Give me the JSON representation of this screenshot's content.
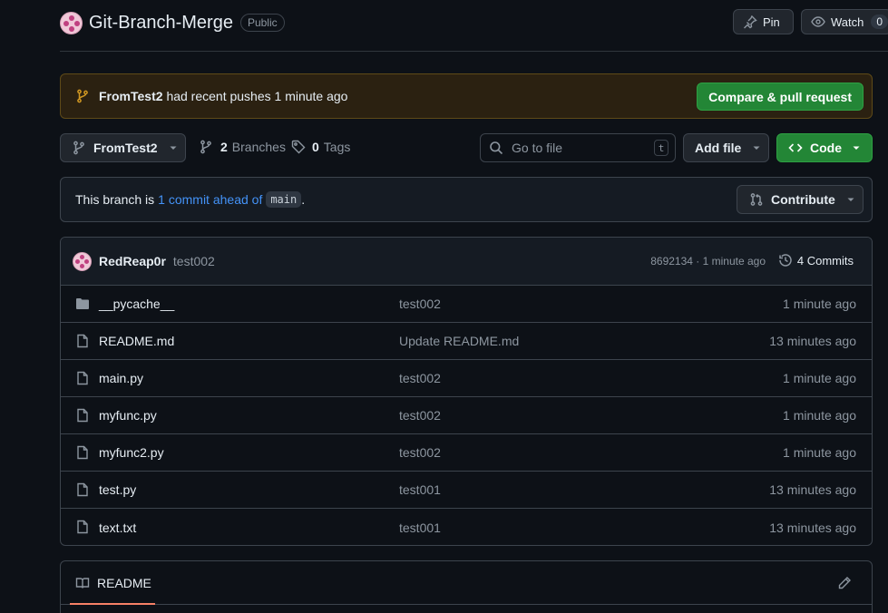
{
  "repo": {
    "name": "Git-Branch-Merge",
    "visibility": "Public",
    "pin_label": "Pin",
    "watch_label": "Watch",
    "watch_count": "0"
  },
  "banner": {
    "branch": "FromTest2",
    "text": "had recent pushes 1 minute ago",
    "compare_label": "Compare & pull request"
  },
  "toolbar": {
    "current_branch": "FromTest2",
    "branches_count": "2",
    "branches_label": "Branches",
    "tags_count": "0",
    "tags_label": "Tags",
    "search_placeholder": "Go to file",
    "search_shortcut": "t",
    "add_file_label": "Add file",
    "code_label": "Code"
  },
  "ahead": {
    "prefix": "This branch is",
    "link": "1 commit ahead of",
    "base_branch": "main",
    "suffix": ".",
    "contribute_label": "Contribute"
  },
  "latest_commit": {
    "author": "RedReap0r",
    "message": "test002",
    "meta": "8692134 · 1 minute ago",
    "commits_label": "4 Commits"
  },
  "files": [
    {
      "name": "__pycache__",
      "type": "folder",
      "message": "test002",
      "time": "1 minute ago"
    },
    {
      "name": "README.md",
      "type": "file",
      "message": "Update README.md",
      "time": "13 minutes ago"
    },
    {
      "name": "main.py",
      "type": "file",
      "message": "test002",
      "time": "1 minute ago"
    },
    {
      "name": "myfunc.py",
      "type": "file",
      "message": "test002",
      "time": "1 minute ago"
    },
    {
      "name": "myfunc2.py",
      "type": "file",
      "message": "test002",
      "time": "1 minute ago"
    },
    {
      "name": "test.py",
      "type": "file",
      "message": "test001",
      "time": "13 minutes ago"
    },
    {
      "name": "text.txt",
      "type": "file",
      "message": "test001",
      "time": "13 minutes ago"
    }
  ],
  "readme": {
    "title": "README"
  },
  "icons": [
    "pin-icon",
    "eye-icon",
    "branch-icon",
    "tag-icon",
    "search-icon",
    "chevron-down-icon",
    "code-icon",
    "pull-request-icon",
    "history-icon",
    "folder-icon",
    "file-icon",
    "book-icon",
    "pencil-icon"
  ],
  "colors": {
    "background": "#0d1117",
    "accent_green": "#238636",
    "link_blue": "#4493f8",
    "banner_bg": "#2b2111",
    "branch_icon_yellow": "#d29922",
    "tab_underline": "#f78166"
  }
}
